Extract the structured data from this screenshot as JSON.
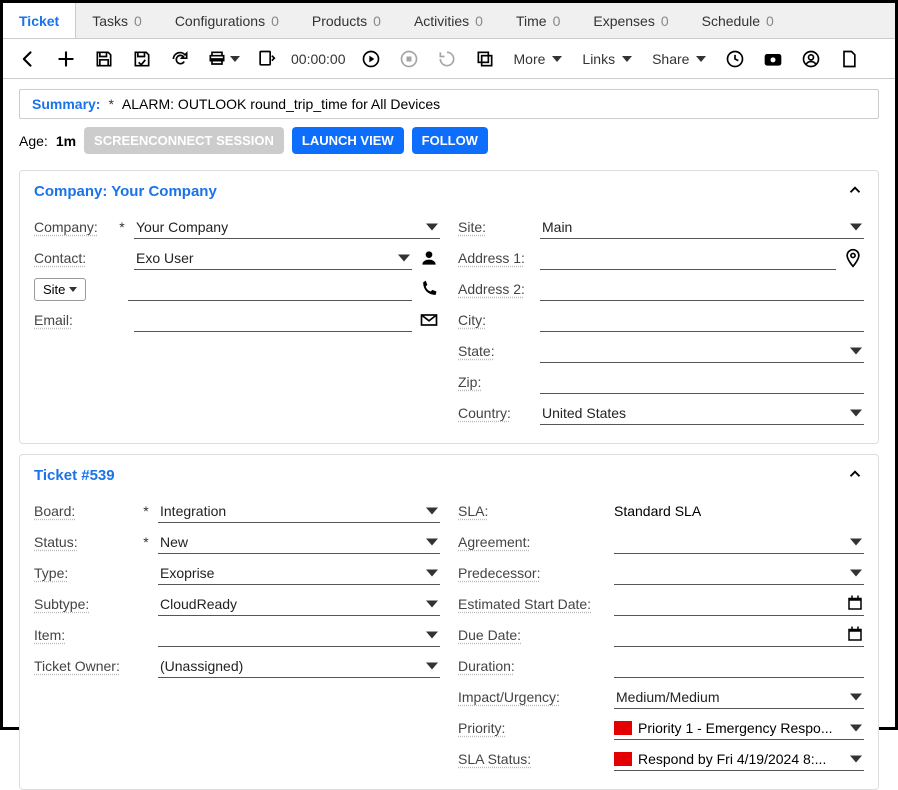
{
  "tabs": [
    {
      "label": "Ticket",
      "count": "",
      "active": true
    },
    {
      "label": "Tasks",
      "count": "0"
    },
    {
      "label": "Configurations",
      "count": "0"
    },
    {
      "label": "Products",
      "count": "0"
    },
    {
      "label": "Activities",
      "count": "0"
    },
    {
      "label": "Time",
      "count": "0"
    },
    {
      "label": "Expenses",
      "count": "0"
    },
    {
      "label": "Schedule",
      "count": "0"
    }
  ],
  "toolbar": {
    "timer": "00:00:00",
    "more": "More",
    "links": "Links",
    "share": "Share"
  },
  "summary": {
    "label": "Summary:",
    "req": "*",
    "text": "ALARM: OUTLOOK round_trip_time for All Devices"
  },
  "age": {
    "label": "Age:",
    "value": "1m"
  },
  "pills": {
    "screenconnect": "SCREENCONNECT SESSION",
    "launch": "LAUNCH VIEW",
    "follow": "FOLLOW"
  },
  "company_panel": {
    "title": "Company: Your Company",
    "company_label": "Company:",
    "company_req": "*",
    "company_value": "Your Company",
    "contact_label": "Contact:",
    "contact_value": "Exo User",
    "site_btn": "Site",
    "email_label": "Email:",
    "site_label": "Site:",
    "site_value": "Main",
    "addr1_label": "Address 1:",
    "addr2_label": "Address 2:",
    "city_label": "City:",
    "state_label": "State:",
    "zip_label": "Zip:",
    "country_label": "Country:",
    "country_value": "United States"
  },
  "ticket_panel": {
    "title": "Ticket #539",
    "board_label": "Board:",
    "board_req": "*",
    "board_value": "Integration",
    "status_label": "Status:",
    "status_req": "*",
    "status_value": "New",
    "type_label": "Type:",
    "type_value": "Exoprise",
    "subtype_label": "Subtype:",
    "subtype_value": "CloudReady",
    "item_label": "Item:",
    "owner_label": "Ticket Owner:",
    "owner_value": "(Unassigned)",
    "sla_label": "SLA:",
    "sla_value": "Standard SLA",
    "agreement_label": "Agreement:",
    "predecessor_label": "Predecessor:",
    "est_start_label": "Estimated Start Date:",
    "due_label": "Due Date:",
    "duration_label": "Duration:",
    "impact_label": "Impact/Urgency:",
    "impact_value": "Medium/Medium",
    "priority_label": "Priority:",
    "priority_value": "Priority 1 - Emergency Respo...",
    "sla_status_label": "SLA Status:",
    "sla_status_value": "Respond by Fri 4/19/2024 8:..."
  }
}
